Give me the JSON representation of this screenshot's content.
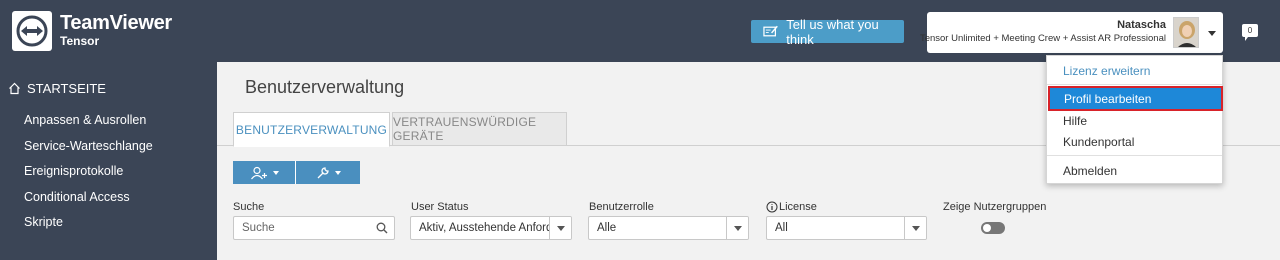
{
  "header": {
    "brand_name_bold": "Team",
    "brand_name_rest": "Viewer",
    "brand_sub": "Tensor",
    "feedback_label": "Tell us what you think",
    "user_name": "Natascha",
    "user_license": "Tensor Unlimited + Meeting Crew + Assist AR Professional",
    "notification_count": "0"
  },
  "sidebar": {
    "heading": "STARTSEITE",
    "items": [
      {
        "label": "Anpassen & Ausrollen"
      },
      {
        "label": "Service-Warteschlange"
      },
      {
        "label": "Ereignisprotokolle"
      },
      {
        "label": "Conditional Access"
      },
      {
        "label": "Skripte"
      }
    ]
  },
  "main": {
    "title": "Benutzerverwaltung",
    "tabs": [
      {
        "label": "BENUTZERVERWALTUNG"
      },
      {
        "label": "VERTRAUENSWÜRDIGE GERÄTE"
      }
    ],
    "filters": {
      "search_label": "Suche",
      "search_placeholder": "Suche",
      "status_label": "User Status",
      "status_value": "Aktiv, Ausstehende Anforden",
      "role_label": "Benutzerrolle",
      "role_value": "Alle",
      "license_label": "License",
      "license_value": "All",
      "groups_label": "Zeige Nutzergruppen"
    }
  },
  "user_menu": {
    "items": [
      {
        "label": "Lizenz erweitern"
      },
      {
        "label": "Profil bearbeiten"
      },
      {
        "label": "Hilfe"
      },
      {
        "label": "Kundenportal"
      },
      {
        "label": "Abmelden"
      }
    ]
  },
  "colors": {
    "topbar": "#3b4556",
    "accent": "#4a90bf",
    "highlight": "#1e88d8",
    "highlight_border": "#d8232a"
  }
}
